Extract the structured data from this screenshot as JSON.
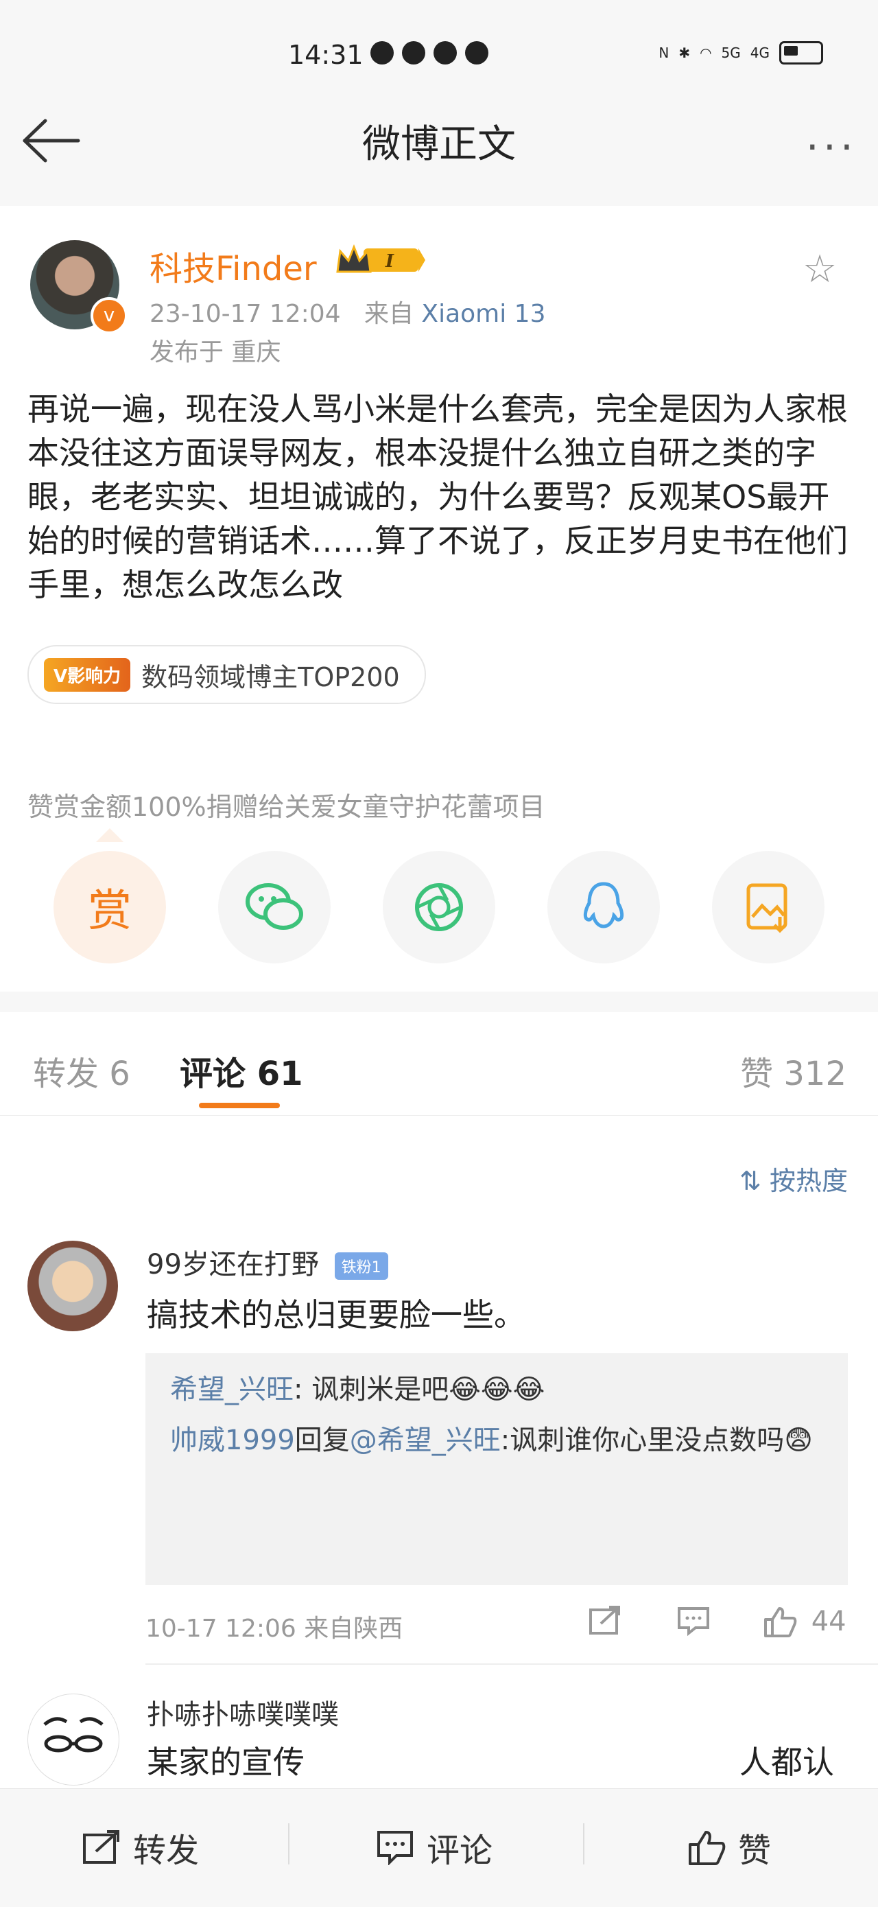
{
  "status_bar": {
    "time": "14:31",
    "signal1": "5G",
    "signal2": "4G"
  },
  "nav": {
    "title": "微博正文",
    "more": "···"
  },
  "post": {
    "author": "科技Finder",
    "level_badge": "I",
    "timestamp": "23-10-17 12:04",
    "source_prefix": "来自",
    "device": "Xiaomi 13",
    "location": "发布于 重庆",
    "content": "再说一遍，现在没人骂小米是什么套壳，完全是因为人家根本没往这方面误导网友，根本没提什么独立自研之类的字眼，老老实实、坦坦诚诚的，为什么要骂？反观某OS最开始的时候的营销话术……算了不说了，反正岁月史书在他们手里，想怎么改怎么改",
    "influence_badge": "V影响力",
    "influence_text": "数码领域博主TOP200",
    "donate_note": "赞赏金额100%捐赠给关爱女童守护花蕾项目",
    "reward_label": "赏"
  },
  "tabs": {
    "repost": "转发 6",
    "comments": "评论 61",
    "likes": "赞 312"
  },
  "sort_label": "按热度",
  "comments": [
    {
      "user": "99岁还在打野",
      "fan_badge": "铁粉1",
      "text": "搞技术的总归更要脸一些。",
      "replies": [
        {
          "user": "希望_兴旺",
          "text": ": 讽刺米是吧😂😂😂"
        },
        {
          "user": "帅威1999",
          "mid": "回复",
          "target": "@希望_兴旺",
          "text": ":讽刺谁你心里没点数吗😨"
        }
      ],
      "time": "10-17 12:06 来自陕西",
      "likes": "44"
    },
    {
      "user": "扑哧扑哧噗噗噗",
      "text_start": "某家的宣传",
      "text_end": "人都认"
    }
  ],
  "bottom_bar": {
    "repost": "转发",
    "comment": "评论",
    "like": "赞"
  },
  "colors": {
    "accent": "#f27b1a",
    "link": "#5b7fa8"
  }
}
